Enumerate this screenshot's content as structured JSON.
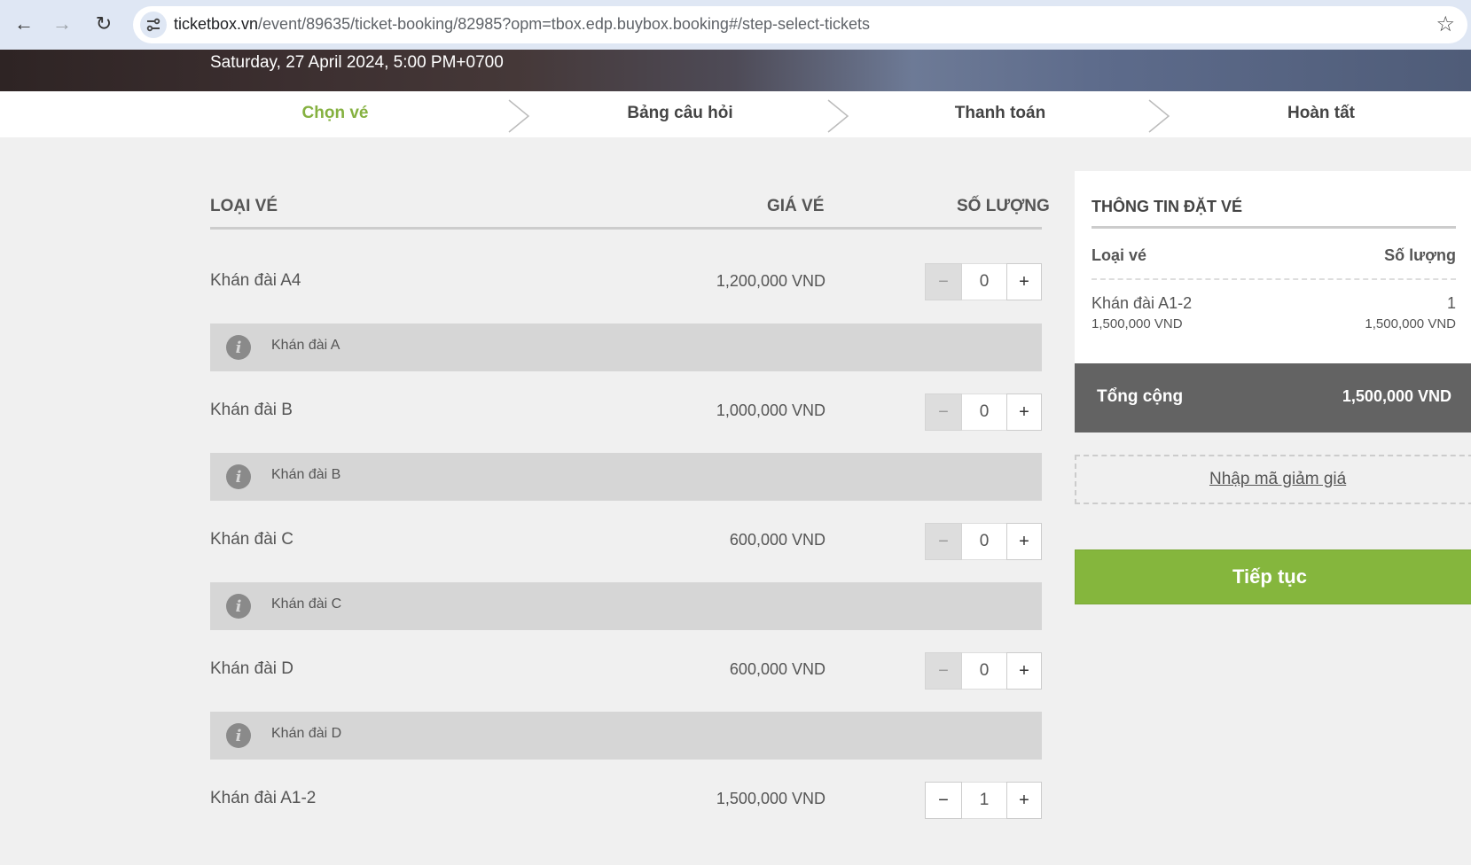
{
  "browser": {
    "url_host": "ticketbox.vn",
    "url_path": "/event/89635/ticket-booking/82985?opm=tbox.edp.buybox.booking#/step-select-tickets"
  },
  "event": {
    "date": "Saturday, 27 April 2024, 5:00 PM+0700"
  },
  "steps": [
    {
      "label": "Chọn vé",
      "active": true
    },
    {
      "label": "Bảng câu hỏi",
      "active": false
    },
    {
      "label": "Thanh toán",
      "active": false
    },
    {
      "label": "Hoàn tất",
      "active": false
    }
  ],
  "table": {
    "col_type": "LOẠI VÉ",
    "col_price": "GIÁ VÉ",
    "col_qty": "SỐ LƯỢNG"
  },
  "tickets": [
    {
      "name": "Khán đài A4",
      "price": "1,200,000 VND",
      "qty": "0",
      "info": "Khán đài A",
      "minus": "−",
      "plus": "+"
    },
    {
      "name": "Khán đài B",
      "price": "1,000,000 VND",
      "qty": "0",
      "info": "Khán đài B",
      "minus": "−",
      "plus": "+"
    },
    {
      "name": "Khán đài C",
      "price": "600,000 VND",
      "qty": "0",
      "info": "Khán đài C",
      "minus": "−",
      "plus": "+"
    },
    {
      "name": "Khán đài D",
      "price": "600,000 VND",
      "qty": "0",
      "info": "Khán đài D",
      "minus": "−",
      "plus": "+"
    },
    {
      "name": "Khán đài A1-2",
      "price": "1,500,000 VND",
      "qty": "1",
      "minus": "−",
      "plus": "+"
    }
  ],
  "summary": {
    "title": "THÔNG TIN ĐẶT VÉ",
    "col_type": "Loại vé",
    "col_qty": "Số lượng",
    "item_name": "Khán đài A1-2",
    "item_price": "1,500,000 VND",
    "item_qty": "1",
    "item_total": "1,500,000 VND",
    "total_label": "Tổng cộng",
    "total_value": "1,500,000 VND"
  },
  "promo": {
    "link": "Nhập mã giảm giá"
  },
  "continue_label": "Tiếp tục"
}
